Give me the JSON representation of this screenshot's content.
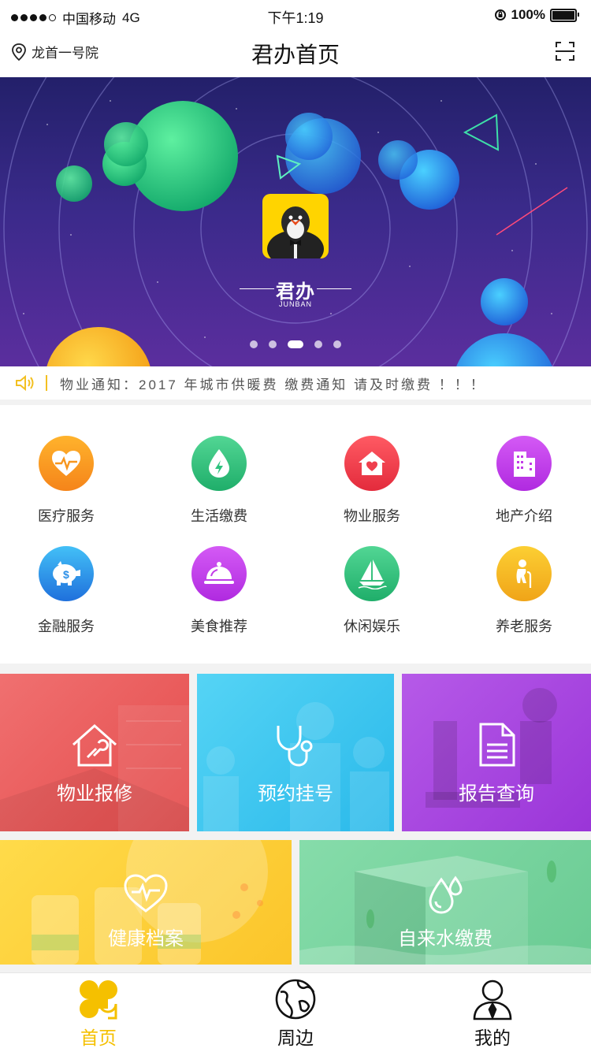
{
  "status_bar": {
    "carrier": "中国移动",
    "network": "4G",
    "time": "下午1:19",
    "battery": "100%"
  },
  "nav": {
    "location": "龙首一号院",
    "title": "君办首页"
  },
  "banner": {
    "brand_cn": "君办",
    "brand_en": "JUNBAN",
    "slide_count": 5,
    "active_slide": 3
  },
  "notice": {
    "text": "物业通知：2017 年城市供暖费 缴费通知 请及时缴费 ！！！"
  },
  "services": [
    {
      "label": "医疗服务",
      "icon": "heartbeat-icon",
      "color": "#f7961e"
    },
    {
      "label": "生活缴费",
      "icon": "water-drop-icon",
      "color": "#2ec27e"
    },
    {
      "label": "物业服务",
      "icon": "house-heart-icon",
      "color": "#ef3f4d"
    },
    {
      "label": "地产介绍",
      "icon": "building-icon",
      "color": "#c23be8"
    },
    {
      "label": "金融服务",
      "icon": "piggy-bank-icon",
      "color": "#2b8fe8"
    },
    {
      "label": "美食推荐",
      "icon": "food-cloche-icon",
      "color": "#c23be8"
    },
    {
      "label": "休闲娱乐",
      "icon": "sailboat-icon",
      "color": "#2ec27e"
    },
    {
      "label": "养老服务",
      "icon": "elderly-icon",
      "color": "#f5b800"
    }
  ],
  "tiles": [
    {
      "label": "物业报修",
      "icon": "house-wrench-icon",
      "color": "#ec5c5c"
    },
    {
      "label": "预约挂号",
      "icon": "stethoscope-icon",
      "color": "#3fc9ee"
    },
    {
      "label": "报告查询",
      "icon": "document-icon",
      "color": "#a844dd"
    },
    {
      "label": "健康档案",
      "icon": "heart-pulse-icon",
      "color": "#fcd33a"
    },
    {
      "label": "自来水缴费",
      "icon": "water-drops-icon",
      "color": "#7cd5a0"
    }
  ],
  "tabs": [
    {
      "label": "首页",
      "icon": "clover-home-icon",
      "active": true
    },
    {
      "label": "周边",
      "icon": "globe-icon",
      "active": false
    },
    {
      "label": "我的",
      "icon": "user-icon",
      "active": false
    }
  ],
  "colors": {
    "accent": "#f5c000"
  }
}
